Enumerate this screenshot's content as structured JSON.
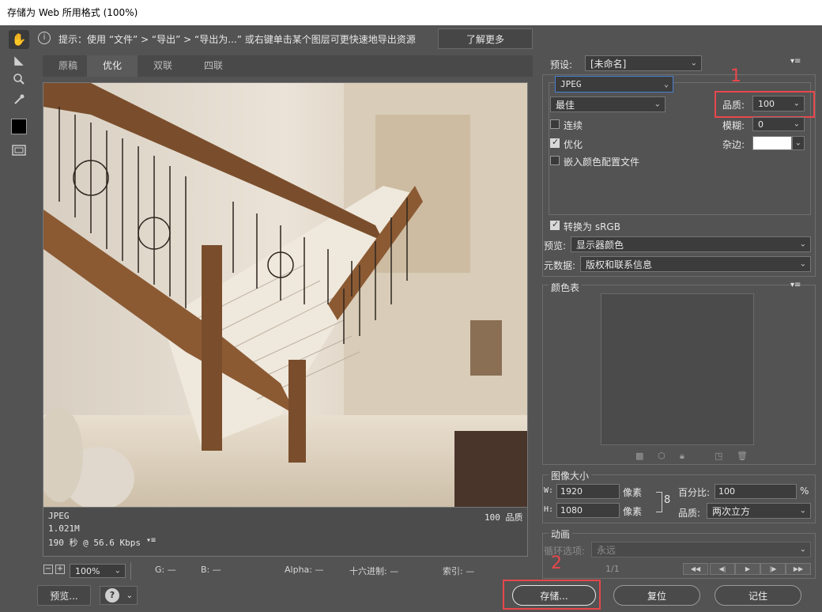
{
  "window": {
    "title": "存储为 Web 所用格式 (100%)"
  },
  "hint": {
    "text": "提示：使用 “文件” > “导出” > “导出为...” 或右键单击某个图层可更快速地导出资源",
    "learn_more": "了解更多"
  },
  "tabs": [
    {
      "label": "原稿"
    },
    {
      "label": "优化"
    },
    {
      "label": "双联"
    },
    {
      "label": "四联"
    }
  ],
  "image_info": {
    "format": "JPEG",
    "size": "1.021M",
    "time": "190 秒 @ 56.6 Kbps",
    "quality": "100 品质"
  },
  "zoom": {
    "value": "100%"
  },
  "status": {
    "g": "G: —",
    "b": "B: —",
    "alpha": "Alpha: —",
    "hex": "十六进制: —",
    "index": "索引: —"
  },
  "buttons": {
    "preview": "预览...",
    "save": "存储...",
    "reset": "复位",
    "remember": "记住",
    "help": "?"
  },
  "settings": {
    "preset_label": "预设:",
    "preset_value": "[未命名]",
    "format": "JPEG",
    "quality_preset": "最佳",
    "quality_label": "品质:",
    "quality_value": "100",
    "blur_label": "模糊:",
    "blur_value": "0",
    "matte_label": "杂边:",
    "progressive": "连续",
    "optimized": "优化",
    "embed_profile": "嵌入颜色配置文件",
    "convert_srgb": "转换为 sRGB",
    "preview_label": "预览:",
    "preview_value": "显示器颜色",
    "metadata_label": "元数据:",
    "metadata_value": "版权和联系信息"
  },
  "color_table": {
    "title": "颜色表"
  },
  "image_size": {
    "title": "图像大小",
    "w_label": "W:",
    "w_value": "1920",
    "h_label": "H:",
    "h_value": "1080",
    "unit": "像素",
    "percent_label": "百分比:",
    "percent_value": "100",
    "percent_unit": "%",
    "quality_label": "品质:",
    "quality_value": "两次立方"
  },
  "animation": {
    "title": "动画",
    "loop_label": "循环选项:",
    "loop_value": "永远",
    "frame": "1/1"
  },
  "annotations": {
    "one": "1",
    "two": "2"
  },
  "colors": {
    "accent_red": "#e8474c",
    "background": "#535353"
  }
}
